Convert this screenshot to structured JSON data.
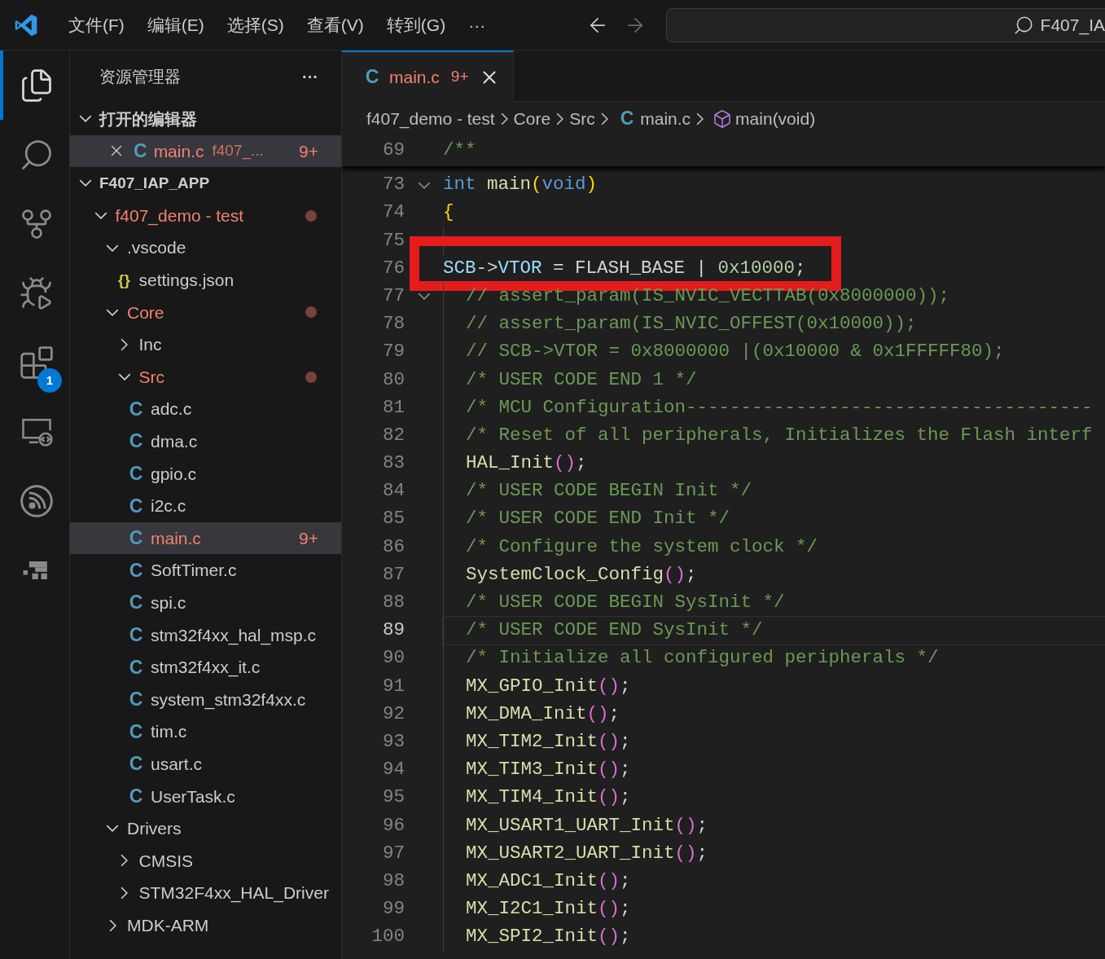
{
  "menu": [
    "文件(F)",
    "编辑(E)",
    "选择(S)",
    "查看(V)",
    "转到(G)",
    "···"
  ],
  "navigation": {
    "back_enabled": true,
    "forward_enabled": false
  },
  "command_center": {
    "text": "F407_IA"
  },
  "activity_bar": [
    {
      "kind": "explorer",
      "selected": true
    },
    {
      "kind": "search",
      "selected": false
    },
    {
      "kind": "source-control",
      "selected": false
    },
    {
      "kind": "run-debug",
      "selected": false
    },
    {
      "kind": "extensions",
      "selected": false,
      "badge": "1"
    },
    {
      "kind": "remote",
      "selected": false
    },
    {
      "kind": "wireless",
      "selected": false
    },
    {
      "kind": "platform",
      "selected": false
    }
  ],
  "sidebar": {
    "title": "资源管理器",
    "more": "···",
    "open_editors": {
      "label": "打开的编辑器",
      "expanded": true,
      "items": [
        {
          "icon": "C",
          "name": "main.c",
          "path": "f407_...",
          "badge": "9+",
          "modified": true,
          "selected": true
        }
      ]
    },
    "workspace": {
      "label": "F407_IAP_APP",
      "expanded": true,
      "tree": [
        {
          "kind": "folder",
          "name": "f407_demo - test",
          "expanded": true,
          "modified": true,
          "dot": true,
          "selected": false,
          "children": [
            {
              "kind": "folder",
              "name": ".vscode",
              "expanded": true,
              "modified": false,
              "dot": false,
              "selected": false,
              "children": [
                {
                  "kind": "json",
                  "icon": "{}",
                  "name": "settings.json",
                  "modified": false,
                  "selected": false
                }
              ]
            },
            {
              "kind": "folder",
              "name": "Core",
              "expanded": true,
              "modified": true,
              "dot": true,
              "selected": false,
              "children": [
                {
                  "kind": "folder",
                  "name": "Inc",
                  "expanded": false,
                  "modified": false,
                  "dot": false,
                  "selected": false
                },
                {
                  "kind": "folder",
                  "name": "Src",
                  "expanded": true,
                  "modified": true,
                  "dot": true,
                  "selected": false,
                  "children": [
                    {
                      "kind": "c",
                      "icon": "C",
                      "name": "adc.c",
                      "modified": false,
                      "selected": false
                    },
                    {
                      "kind": "c",
                      "icon": "C",
                      "name": "dma.c",
                      "modified": false,
                      "selected": false
                    },
                    {
                      "kind": "c",
                      "icon": "C",
                      "name": "gpio.c",
                      "modified": false,
                      "selected": false
                    },
                    {
                      "kind": "c",
                      "icon": "C",
                      "name": "i2c.c",
                      "modified": false,
                      "selected": false
                    },
                    {
                      "kind": "c",
                      "icon": "C",
                      "name": "main.c",
                      "modified": true,
                      "badge": "9+",
                      "selected": true
                    },
                    {
                      "kind": "c",
                      "icon": "C",
                      "name": "SoftTimer.c",
                      "modified": false,
                      "selected": false
                    },
                    {
                      "kind": "c",
                      "icon": "C",
                      "name": "spi.c",
                      "modified": false,
                      "selected": false
                    },
                    {
                      "kind": "c",
                      "icon": "C",
                      "name": "stm32f4xx_hal_msp.c",
                      "modified": false,
                      "selected": false
                    },
                    {
                      "kind": "c",
                      "icon": "C",
                      "name": "stm32f4xx_it.c",
                      "modified": false,
                      "selected": false
                    },
                    {
                      "kind": "c",
                      "icon": "C",
                      "name": "system_stm32f4xx.c",
                      "modified": false,
                      "selected": false
                    },
                    {
                      "kind": "c",
                      "icon": "C",
                      "name": "tim.c",
                      "modified": false,
                      "selected": false
                    },
                    {
                      "kind": "c",
                      "icon": "C",
                      "name": "usart.c",
                      "modified": false,
                      "selected": false
                    },
                    {
                      "kind": "c",
                      "icon": "C",
                      "name": "UserTask.c",
                      "modified": false,
                      "selected": false
                    }
                  ]
                }
              ]
            },
            {
              "kind": "folder",
              "name": "Drivers",
              "expanded": true,
              "modified": false,
              "dot": false,
              "selected": false,
              "children": [
                {
                  "kind": "folder",
                  "name": "CMSIS",
                  "expanded": false,
                  "modified": false,
                  "dot": false,
                  "selected": false
                },
                {
                  "kind": "folder",
                  "name": "STM32F4xx_HAL_Driver",
                  "expanded": false,
                  "modified": false,
                  "dot": false,
                  "selected": false
                }
              ]
            },
            {
              "kind": "folder",
              "name": "MDK-ARM",
              "expanded": false,
              "modified": false,
              "dot": false,
              "selected": false
            }
          ]
        }
      ]
    }
  },
  "editor": {
    "tabs": [
      {
        "icon": "C",
        "label": "main.c",
        "badge": "9+",
        "modified": true,
        "selected": true
      }
    ],
    "breadcrumbs": [
      {
        "kind": "folder",
        "label": "f407_demo - test"
      },
      {
        "kind": "folder",
        "label": "Core"
      },
      {
        "kind": "folder",
        "label": "Src"
      },
      {
        "kind": "file",
        "icon": "C",
        "label": "main.c"
      },
      {
        "kind": "symbol",
        "label": "main(void)"
      }
    ],
    "sticky_line": {
      "number": "69",
      "tokens": [
        {
          "kind": "comment",
          "text": "/**"
        }
      ]
    },
    "lines": [
      {
        "number": "73",
        "fold": true,
        "indented": false,
        "current": false,
        "highlighted": false,
        "tokens": [
          {
            "kind": "keyword",
            "text": "int"
          },
          {
            "kind": "function",
            "text": "main",
            "spaced": true
          },
          {
            "kind": "bracket",
            "text": "("
          },
          {
            "kind": "keyword",
            "text": "void"
          },
          {
            "kind": "bracket",
            "text": ")"
          }
        ]
      },
      {
        "number": "74",
        "fold": false,
        "indented": false,
        "current": false,
        "highlighted": false,
        "tokens": [
          {
            "kind": "bracket",
            "text": "{"
          }
        ]
      },
      {
        "number": "75",
        "fold": false,
        "indented": true,
        "current": false,
        "highlighted": false
      },
      {
        "number": "76",
        "fold": false,
        "indented": false,
        "current": false,
        "highlighted": true,
        "tokens": [
          {
            "kind": "variable",
            "text": "SCB"
          },
          {
            "kind": "plain",
            "text": "->"
          },
          {
            "kind": "variable",
            "text": "VTOR"
          },
          {
            "kind": "plain",
            "text": " = FLASH_BASE | "
          },
          {
            "kind": "number",
            "text": "0x10000"
          },
          {
            "kind": "plain",
            "text": ";"
          }
        ]
      },
      {
        "number": "77",
        "fold": true,
        "indented": true,
        "current": false,
        "highlighted": false,
        "tokens": [
          {
            "kind": "comment",
            "text": "// assert_param(IS_NVIC_VECTTAB(0x8000000));"
          }
        ]
      },
      {
        "number": "78",
        "fold": false,
        "indented": true,
        "current": false,
        "highlighted": false,
        "tokens": [
          {
            "kind": "comment",
            "text": "// assert_param(IS_NVIC_OFFEST(0x10000));"
          }
        ]
      },
      {
        "number": "79",
        "fold": false,
        "indented": true,
        "current": false,
        "highlighted": false,
        "tokens": [
          {
            "kind": "comment",
            "text": "// SCB->VTOR = 0x8000000 |(0x10000 & 0x1FFFFF80);"
          }
        ]
      },
      {
        "number": "80",
        "fold": false,
        "indented": true,
        "current": false,
        "highlighted": false,
        "tokens": [
          {
            "kind": "comment",
            "text": "/* USER CODE END 1 */"
          }
        ]
      },
      {
        "number": "81",
        "fold": false,
        "indented": true,
        "current": false,
        "highlighted": false,
        "tokens": [
          {
            "kind": "comment",
            "text": "/* MCU Configuration-------------------------------------"
          }
        ]
      },
      {
        "number": "82",
        "fold": false,
        "indented": true,
        "current": false,
        "highlighted": false,
        "tokens": [
          {
            "kind": "comment",
            "text": "/* Reset of all peripherals, Initializes the Flash interf"
          }
        ]
      },
      {
        "number": "83",
        "fold": false,
        "indented": true,
        "current": false,
        "highlighted": false,
        "tokens": [
          {
            "kind": "function",
            "text": "HAL_Init"
          },
          {
            "kind": "bracket2",
            "text": "()"
          },
          {
            "kind": "plain",
            "text": ";"
          }
        ]
      },
      {
        "number": "84",
        "fold": false,
        "indented": true,
        "current": false,
        "highlighted": false,
        "tokens": [
          {
            "kind": "comment",
            "text": "/* USER CODE BEGIN Init */"
          }
        ]
      },
      {
        "number": "85",
        "fold": false,
        "indented": true,
        "current": false,
        "highlighted": false,
        "tokens": [
          {
            "kind": "comment",
            "text": "/* USER CODE END Init */"
          }
        ]
      },
      {
        "number": "86",
        "fold": false,
        "indented": true,
        "current": false,
        "highlighted": false,
        "tokens": [
          {
            "kind": "comment",
            "text": "/* Configure the system clock */"
          }
        ]
      },
      {
        "number": "87",
        "fold": false,
        "indented": true,
        "current": false,
        "highlighted": false,
        "tokens": [
          {
            "kind": "function",
            "text": "SystemClock_Config"
          },
          {
            "kind": "bracket2",
            "text": "()"
          },
          {
            "kind": "plain",
            "text": ";"
          }
        ]
      },
      {
        "number": "88",
        "fold": false,
        "indented": true,
        "current": false,
        "highlighted": false,
        "tokens": [
          {
            "kind": "comment",
            "text": "/* USER CODE BEGIN SysInit */"
          }
        ]
      },
      {
        "number": "89",
        "fold": false,
        "indented": true,
        "current": true,
        "highlighted": false,
        "tokens": [
          {
            "kind": "comment",
            "text": "/* USER CODE END SysInit */"
          }
        ]
      },
      {
        "number": "90",
        "fold": false,
        "indented": true,
        "current": false,
        "highlighted": false,
        "tokens": [
          {
            "kind": "comment",
            "text": "/* Initialize all configured peripherals */"
          }
        ]
      },
      {
        "number": "91",
        "fold": false,
        "indented": true,
        "current": false,
        "highlighted": false,
        "tokens": [
          {
            "kind": "function",
            "text": "MX_GPIO_Init"
          },
          {
            "kind": "bracket2",
            "text": "()"
          },
          {
            "kind": "plain",
            "text": ";"
          }
        ]
      },
      {
        "number": "92",
        "fold": false,
        "indented": true,
        "current": false,
        "highlighted": false,
        "tokens": [
          {
            "kind": "function",
            "text": "MX_DMA_Init"
          },
          {
            "kind": "bracket2",
            "text": "()"
          },
          {
            "kind": "plain",
            "text": ";"
          }
        ]
      },
      {
        "number": "93",
        "fold": false,
        "indented": true,
        "current": false,
        "highlighted": false,
        "tokens": [
          {
            "kind": "function",
            "text": "MX_TIM2_Init"
          },
          {
            "kind": "bracket2",
            "text": "()"
          },
          {
            "kind": "plain",
            "text": ";"
          }
        ]
      },
      {
        "number": "94",
        "fold": false,
        "indented": true,
        "current": false,
        "highlighted": false,
        "tokens": [
          {
            "kind": "function",
            "text": "MX_TIM3_Init"
          },
          {
            "kind": "bracket2",
            "text": "()"
          },
          {
            "kind": "plain",
            "text": ";"
          }
        ]
      },
      {
        "number": "95",
        "fold": false,
        "indented": true,
        "current": false,
        "highlighted": false,
        "tokens": [
          {
            "kind": "function",
            "text": "MX_TIM4_Init"
          },
          {
            "kind": "bracket2",
            "text": "()"
          },
          {
            "kind": "plain",
            "text": ";"
          }
        ]
      },
      {
        "number": "96",
        "fold": false,
        "indented": true,
        "current": false,
        "highlighted": false,
        "tokens": [
          {
            "kind": "function",
            "text": "MX_USART1_UART_Init"
          },
          {
            "kind": "bracket2",
            "text": "()"
          },
          {
            "kind": "plain",
            "text": ";"
          }
        ]
      },
      {
        "number": "97",
        "fold": false,
        "indented": true,
        "current": false,
        "highlighted": false,
        "tokens": [
          {
            "kind": "function",
            "text": "MX_USART2_UART_Init"
          },
          {
            "kind": "bracket2",
            "text": "()"
          },
          {
            "kind": "plain",
            "text": ";"
          }
        ]
      },
      {
        "number": "98",
        "fold": false,
        "indented": true,
        "current": false,
        "highlighted": false,
        "tokens": [
          {
            "kind": "function",
            "text": "MX_ADC1_Init"
          },
          {
            "kind": "bracket2",
            "text": "()"
          },
          {
            "kind": "plain",
            "text": ";"
          }
        ]
      },
      {
        "number": "99",
        "fold": false,
        "indented": true,
        "current": false,
        "highlighted": false,
        "tokens": [
          {
            "kind": "function",
            "text": "MX_I2C1_Init"
          },
          {
            "kind": "bracket2",
            "text": "()"
          },
          {
            "kind": "plain",
            "text": ";"
          }
        ]
      },
      {
        "number": "100",
        "fold": false,
        "indented": true,
        "current": false,
        "highlighted": false,
        "tokens": [
          {
            "kind": "function",
            "text": "MX_SPI2_Init"
          },
          {
            "kind": "bracket2",
            "text": "()"
          },
          {
            "kind": "plain",
            "text": ";"
          }
        ]
      }
    ]
  }
}
